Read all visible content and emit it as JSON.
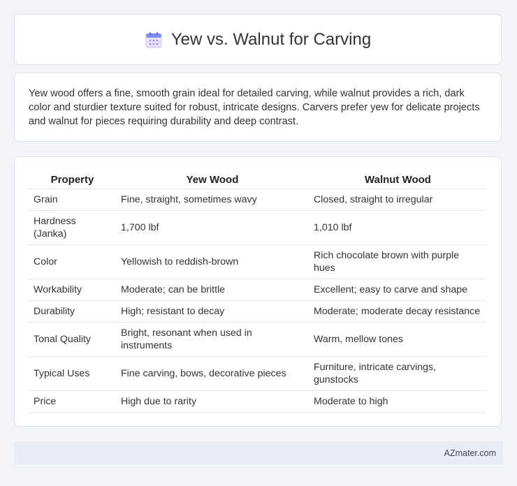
{
  "header": {
    "title": "Yew vs. Walnut for Carving",
    "icon": "calendar-icon"
  },
  "intro": "Yew wood offers a fine, smooth grain ideal for detailed carving, while walnut provides a rich, dark color and sturdier texture suited for robust, intricate designs. Carvers prefer yew for delicate projects and walnut for pieces requiring durability and deep contrast.",
  "table": {
    "headers": [
      "Property",
      "Yew Wood",
      "Walnut Wood"
    ],
    "rows": [
      [
        "Grain",
        "Fine, straight, sometimes wavy",
        "Closed, straight to irregular"
      ],
      [
        "Hardness (Janka)",
        "1,700 lbf",
        "1,010 lbf"
      ],
      [
        "Color",
        "Yellowish to reddish-brown",
        "Rich chocolate brown with purple hues"
      ],
      [
        "Workability",
        "Moderate; can be brittle",
        "Excellent; easy to carve and shape"
      ],
      [
        "Durability",
        "High; resistant to decay",
        "Moderate; moderate decay resistance"
      ],
      [
        "Tonal Quality",
        "Bright, resonant when used in instruments",
        "Warm, mellow tones"
      ],
      [
        "Typical Uses",
        "Fine carving, bows, decorative pieces",
        "Furniture, intricate carvings, gunstocks"
      ],
      [
        "Price",
        "High due to rarity",
        "Moderate to high"
      ]
    ]
  },
  "footer": {
    "brand": "AZmater.com"
  }
}
